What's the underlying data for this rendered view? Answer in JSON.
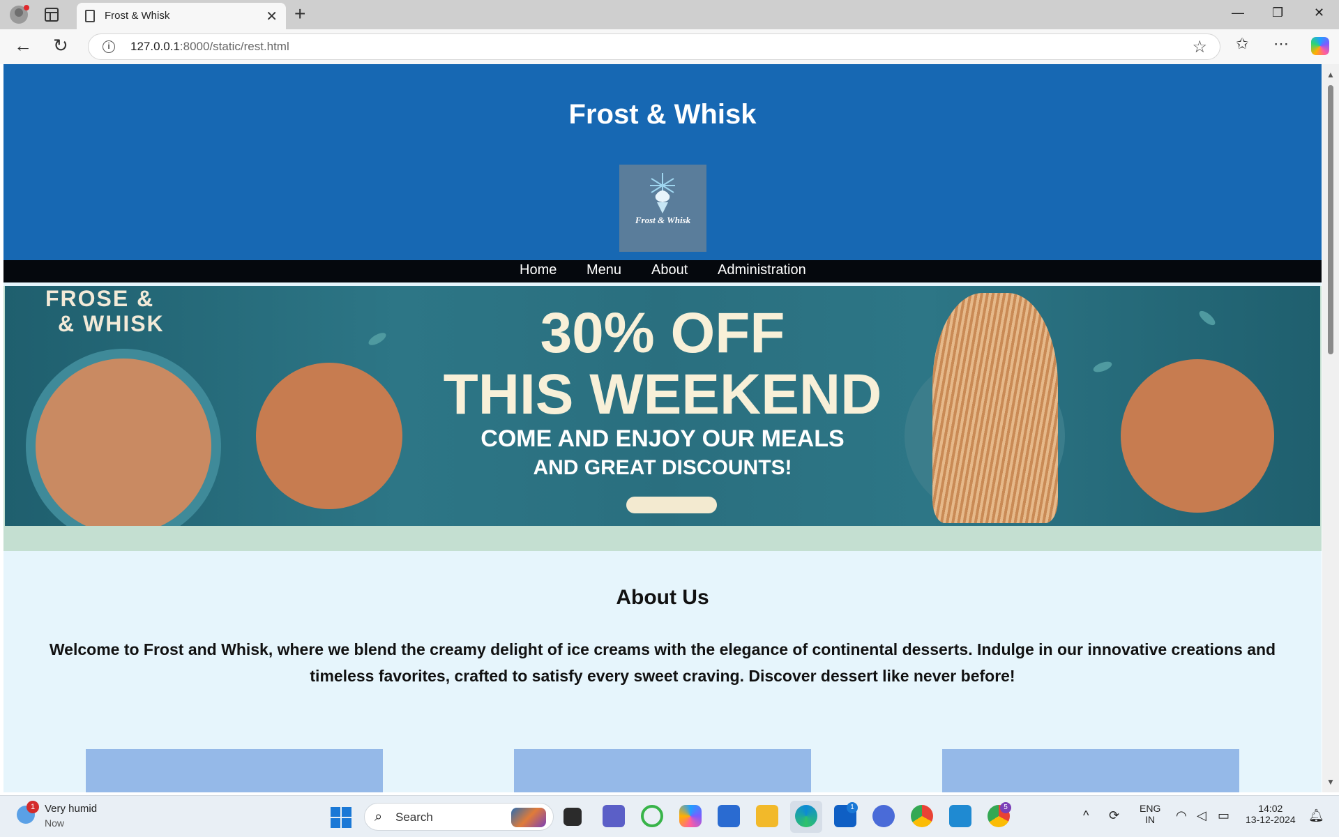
{
  "browser": {
    "tab_title": "Frost & Whisk",
    "url_host": "127.0.0.1",
    "url_rest": ":8000/static/rest.html",
    "window_controls": {
      "minimize": "—",
      "restore": "❐",
      "close": "✕"
    }
  },
  "site": {
    "title": "Frost & Whisk",
    "logo_text": "Frost & Whisk",
    "nav": [
      "Home",
      "Menu",
      "About",
      "Administration"
    ],
    "banner": {
      "brand_line1": "FROSE &",
      "brand_line2": "& WHISK",
      "headline1": "30% OFF",
      "headline2": "THIS WEEKEND",
      "sub1": "COME AND ENJOY OUR MEALS",
      "sub2": "AND GREAT DISCOUNTS!"
    },
    "about": {
      "title": "About Us",
      "text": "Welcome to Frost and Whisk, where we blend the creamy delight of ice creams with the elegance of continental desserts. Indulge in our innovative creations and timeless favorites, crafted to satisfy every sweet craving. Discover dessert like never before!"
    },
    "colors": {
      "header": "#1768b3",
      "nav": "#05080d",
      "page_bg": "#e6f5fc",
      "card": "#95b9e8"
    }
  },
  "taskbar": {
    "weather_badge": "1",
    "weather_title": "Very humid",
    "weather_sub": "Now",
    "search_label": "Search",
    "lens_badge": "1",
    "chrome_badge": "5",
    "lang_line1": "ENG",
    "lang_line2": "IN",
    "time": "14:02",
    "date": "13-12-2024"
  }
}
